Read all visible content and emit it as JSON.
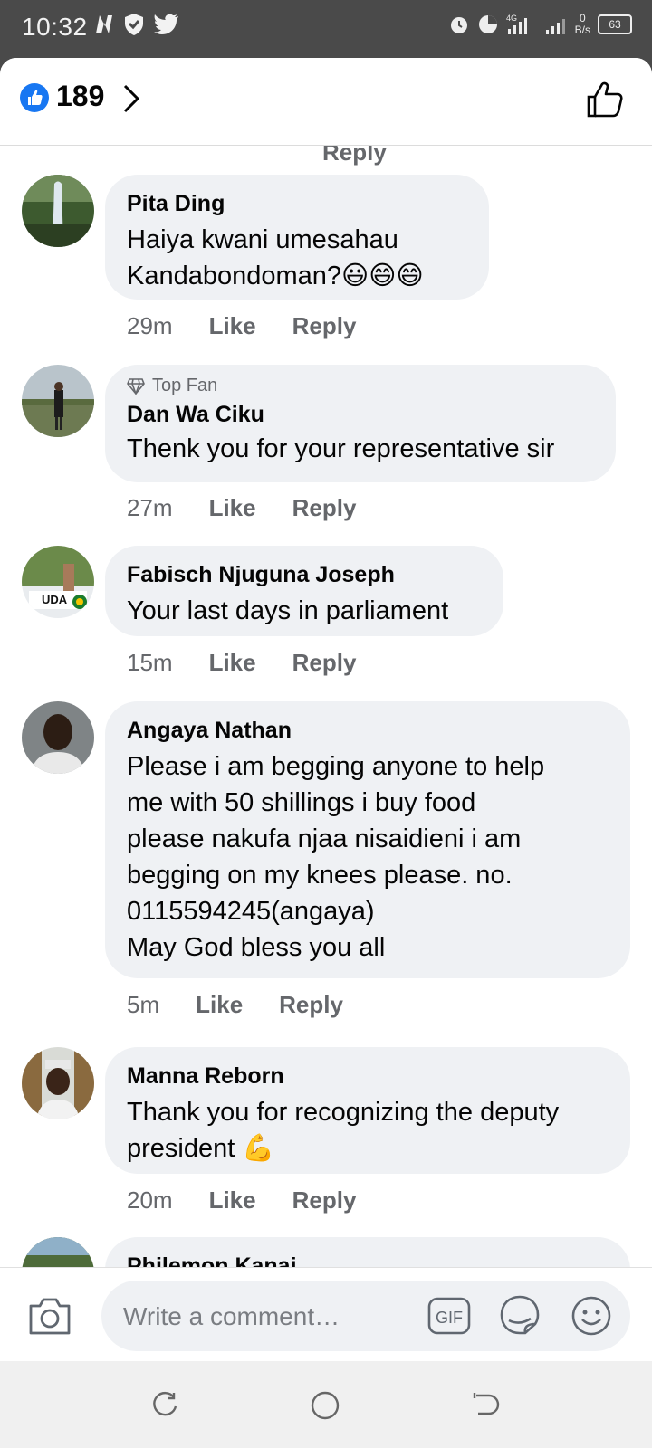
{
  "status_bar": {
    "time": "10:32",
    "network_type": "4G",
    "net_speed_value": "0",
    "net_speed_unit": "B/s",
    "battery_level": "63"
  },
  "header": {
    "reaction_count": "189"
  },
  "comments_top_cut_text": "Reply",
  "comments": [
    {
      "author": "Pita Ding",
      "text": "Haiya kwani umesahau\nKandabondoman?😃😄😄",
      "time": "29m",
      "like_label": "Like",
      "reply_label": "Reply",
      "badge": ""
    },
    {
      "author": "Dan Wa Ciku",
      "text": "Thenk you for your representative sir",
      "time": "27m",
      "like_label": "Like",
      "reply_label": "Reply",
      "badge": "Top Fan"
    },
    {
      "author": "Fabisch Njuguna Joseph",
      "text": "Your last days in parliament",
      "time": "15m",
      "like_label": "Like",
      "reply_label": "Reply",
      "badge": "",
      "avatar_text": "UDA"
    },
    {
      "author": "Angaya Nathan",
      "text": "Please i am begging anyone to help\nme with 50 shillings i buy food\nplease nakufa njaa nisaidieni i am\nbegging on my knees please. no.\n0115594245(angaya)\nMay God bless you all",
      "time": "5m",
      "like_label": "Like",
      "reply_label": "Reply",
      "badge": ""
    },
    {
      "author": "Manna Reborn",
      "text": "Thank you for recognizing the deputy\npresident 💪",
      "time": "20m",
      "like_label": "Like",
      "reply_label": "Reply",
      "badge": ""
    },
    {
      "author": "Philemon Kanai",
      "text": "",
      "time": "",
      "like_label": "",
      "reply_label": "",
      "badge": ""
    }
  ],
  "composer": {
    "placeholder": "Write a comment…",
    "gif_label": "GIF"
  },
  "colors": {
    "facebook_blue": "#1877f2",
    "bubble_bg": "#eff1f4",
    "meta_gray": "#65676b",
    "status_bar_bg": "#4a4a4a"
  }
}
